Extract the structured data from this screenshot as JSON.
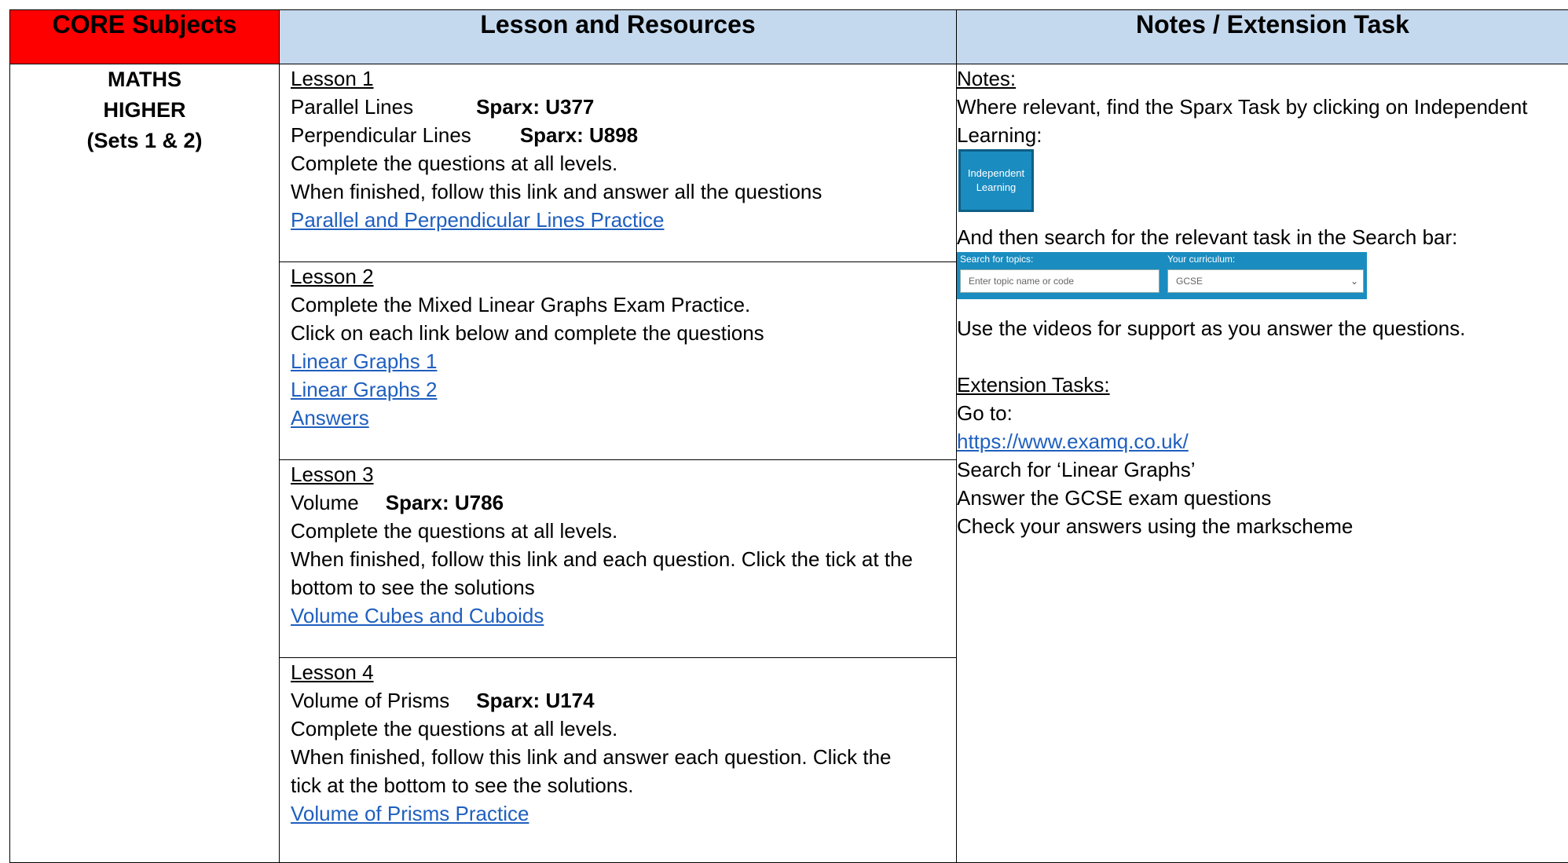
{
  "headers": {
    "core": "CORE Subjects",
    "lesson": "Lesson and Resources",
    "notes": "Notes / Extension Task"
  },
  "subject": {
    "line1": "MATHS",
    "line2": "HIGHER",
    "line3": "(Sets 1 & 2)"
  },
  "lessons": [
    {
      "title": "Lesson 1",
      "items": [
        {
          "text": "Parallel Lines",
          "code": "Sparx: U377"
        },
        {
          "text": "Perpendicular Lines",
          "code": "Sparx: U898"
        }
      ],
      "line1": "Complete the questions at all levels.",
      "line2": "When finished, follow this link and answer all the questions",
      "link": "Parallel and Perpendicular Lines Practice"
    },
    {
      "title": "Lesson 2",
      "line1": "Complete the Mixed Linear Graphs Exam Practice.",
      "line2": "Click on each link below and complete the questions",
      "links": [
        "Linear Graphs 1",
        "Linear Graphs 2",
        "Answers"
      ]
    },
    {
      "title": "Lesson 3",
      "items": [
        {
          "text": "Volume",
          "code": "Sparx: U786"
        }
      ],
      "line1": "Complete the questions at all levels.",
      "line2": "When finished, follow this link and each question. Click the tick at the",
      "line3": "bottom to see the solutions",
      "link": "Volume Cubes and Cuboids"
    },
    {
      "title": "Lesson 4",
      "items": [
        {
          "text": "Volume of Prisms",
          "code": "Sparx: U174"
        }
      ],
      "line1": "Complete the questions at all levels.",
      "line2": "When finished, follow this link and answer each question. Click the",
      "line3": "tick at the bottom to see the solutions.",
      "link": "Volume of Prisms Practice"
    }
  ],
  "notes": {
    "heading": "Notes:",
    "line1": "Where relevant, find the Sparx Task by clicking on Independent",
    "line2": "Learning:",
    "il_button_line1": "Independent",
    "il_button_line2": "Learning",
    "search_line": "And then search for the relevant task in the Search bar:",
    "search_label_topics": "Search for topics:",
    "search_placeholder": "Enter topic name or code",
    "curriculum_label": "Your curriculum:",
    "curriculum_value": "GCSE",
    "videos_line": "Use the videos for support as you answer the questions.",
    "ext_heading": "Extension Tasks:",
    "goto": "Go to:",
    "url": "https://www.examq.co.uk/",
    "ext_line1": "Search for ‘Linear Graphs’",
    "ext_line2": "Answer the GCSE exam questions",
    "ext_line3": "Check your answers using the markscheme"
  },
  "colors": {
    "core_header_bg": "#ff0000",
    "header_bg": "#c5d9ee",
    "link": "#1f5fbf",
    "sparx_blue": "#1a8cc0"
  }
}
